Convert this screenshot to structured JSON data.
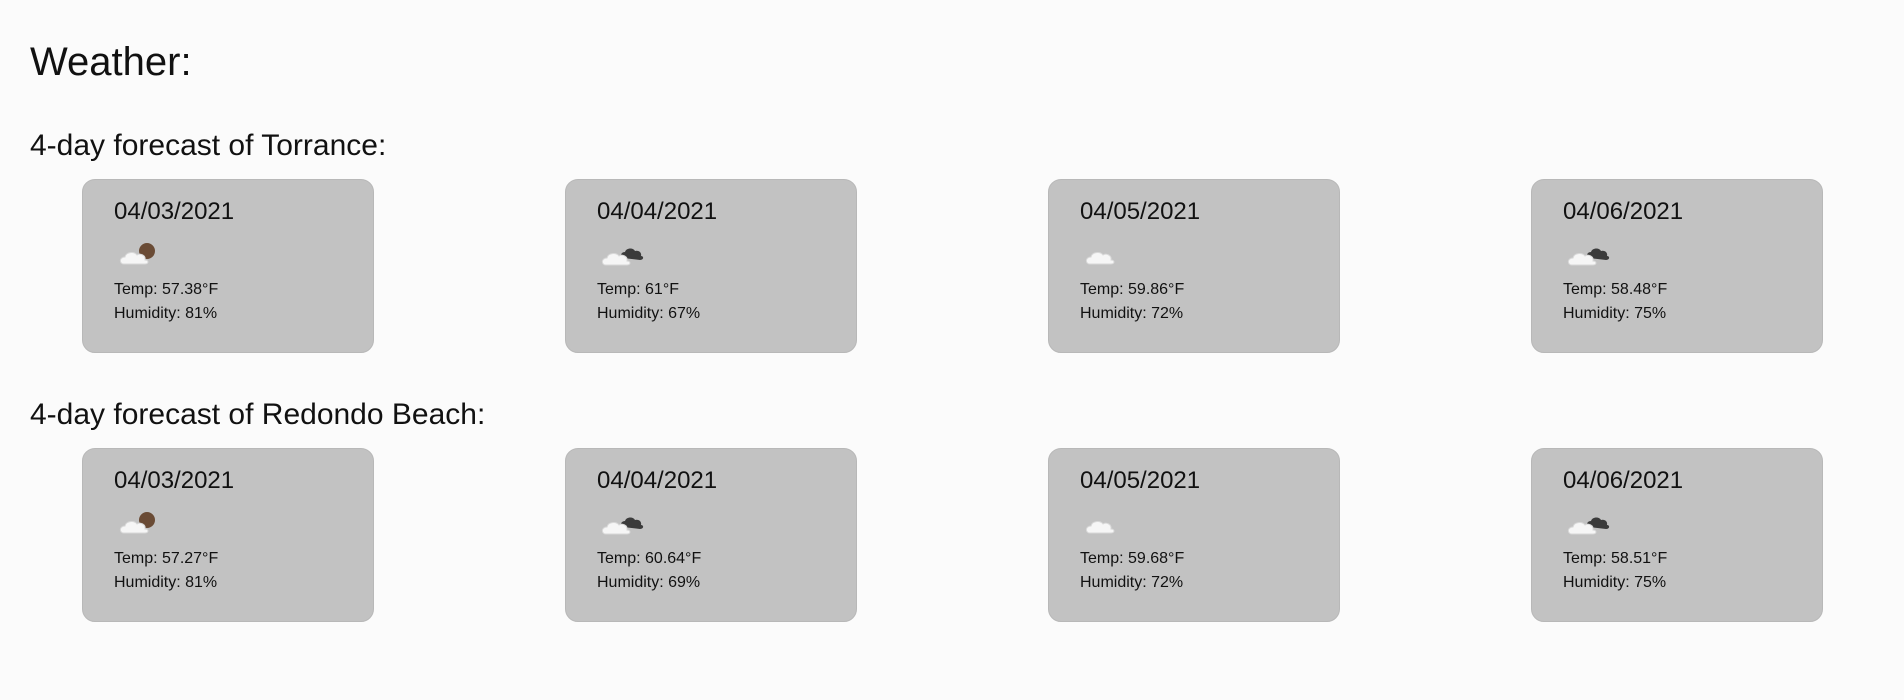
{
  "page": {
    "title": "Weather:"
  },
  "sections": [
    {
      "title": "4-day forecast of Torrance:",
      "days": [
        {
          "date": "04/03/2021",
          "icon": "cloud-partly-brown-icon",
          "temp": "Temp: 57.38°F",
          "humidity": "Humidity: 81%"
        },
        {
          "date": "04/04/2021",
          "icon": "broken-clouds-icon",
          "temp": "Temp: 61°F",
          "humidity": "Humidity: 67%"
        },
        {
          "date": "04/05/2021",
          "icon": "cloud-icon",
          "temp": "Temp: 59.86°F",
          "humidity": "Humidity: 72%"
        },
        {
          "date": "04/06/2021",
          "icon": "broken-clouds-icon",
          "temp": "Temp: 58.48°F",
          "humidity": "Humidity: 75%"
        }
      ]
    },
    {
      "title": "4-day forecast of Redondo Beach:",
      "days": [
        {
          "date": "04/03/2021",
          "icon": "cloud-partly-brown-icon",
          "temp": "Temp: 57.27°F",
          "humidity": "Humidity: 81%"
        },
        {
          "date": "04/04/2021",
          "icon": "broken-clouds-icon",
          "temp": "Temp: 60.64°F",
          "humidity": "Humidity: 69%"
        },
        {
          "date": "04/05/2021",
          "icon": "cloud-icon",
          "temp": "Temp: 59.68°F",
          "humidity": "Humidity: 72%"
        },
        {
          "date": "04/06/2021",
          "icon": "broken-clouds-icon",
          "temp": "Temp: 58.51°F",
          "humidity": "Humidity: 75%"
        }
      ]
    }
  ],
  "colors": {
    "background": "#fbfbfb",
    "card": "#c2c2c2",
    "text": "#111111"
  }
}
